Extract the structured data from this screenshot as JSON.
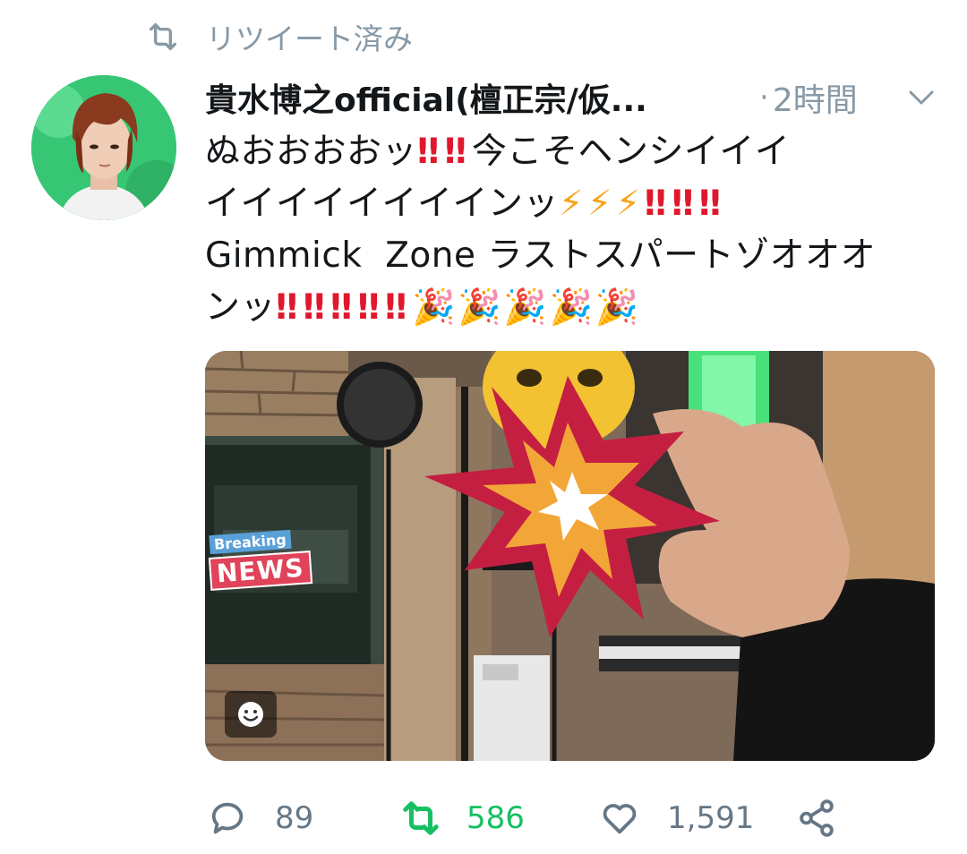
{
  "retweet_banner": {
    "label": "リツイート済み",
    "icon": "retweet-icon"
  },
  "tweet": {
    "display_name": "貴水博之official(檀正宗/仮...",
    "separator": "·",
    "timestamp": "2時間",
    "menu_icon": "chevron-down-icon",
    "text_lines": [
      [
        "ぬおおおおッ",
        "‼",
        "‼",
        "今こそヘンシイイイ"
      ],
      [
        "イイイイイイイインッ",
        "⚡",
        "⚡",
        "⚡",
        "‼",
        "‼",
        "‼"
      ],
      [
        "Gimmick Zone ラストスパートゾオオオ"
      ],
      [
        "ンッ",
        "‼",
        "‼",
        "‼",
        "‼",
        "‼",
        "🎉",
        "🎉",
        "🎉",
        "🎉",
        "🎉"
      ]
    ],
    "line1_text": "ぬおおおおッ",
    "line1_end": "今こそヘンシイイイ",
    "line2_text": "イイイイイイイインッ",
    "line3_text": "Gimmick  Zone ラストスパートゾオオオ",
    "line4_text": "ンッ",
    "bang": "‼",
    "bolt": "⚡",
    "popper": "🎉"
  },
  "media": {
    "sticker_top": "Breaking",
    "sticker_bottom": "NEWS",
    "sticker_button_icon": "smiley-icon"
  },
  "actions": {
    "reply_count": "89",
    "retweet_count": "586",
    "like_count": "1,591"
  },
  "colors": {
    "text": "#14171a",
    "muted": "#8899a6",
    "retweeted": "#17bf63",
    "action_gray": "#657786",
    "emphasis_red": "#e0182d",
    "bolt_yellow": "#f7a51c",
    "popper_magenta": "#d61fd0"
  }
}
